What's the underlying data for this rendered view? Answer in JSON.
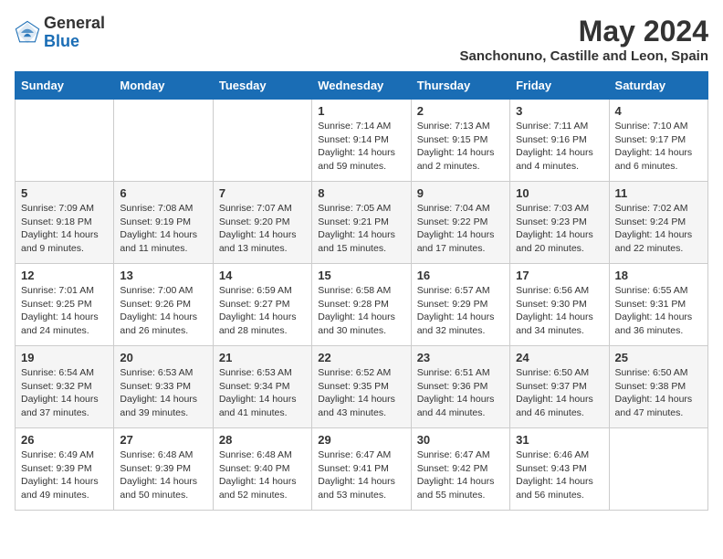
{
  "header": {
    "logo_general": "General",
    "logo_blue": "Blue",
    "title": "May 2024",
    "location": "Sanchonuno, Castille and Leon, Spain"
  },
  "columns": [
    "Sunday",
    "Monday",
    "Tuesday",
    "Wednesday",
    "Thursday",
    "Friday",
    "Saturday"
  ],
  "weeks": [
    [
      {
        "day": "",
        "info": ""
      },
      {
        "day": "",
        "info": ""
      },
      {
        "day": "",
        "info": ""
      },
      {
        "day": "1",
        "info": "Sunrise: 7:14 AM\nSunset: 9:14 PM\nDaylight: 14 hours and 59 minutes."
      },
      {
        "day": "2",
        "info": "Sunrise: 7:13 AM\nSunset: 9:15 PM\nDaylight: 14 hours and 2 minutes."
      },
      {
        "day": "3",
        "info": "Sunrise: 7:11 AM\nSunset: 9:16 PM\nDaylight: 14 hours and 4 minutes."
      },
      {
        "day": "4",
        "info": "Sunrise: 7:10 AM\nSunset: 9:17 PM\nDaylight: 14 hours and 6 minutes."
      }
    ],
    [
      {
        "day": "5",
        "info": "Sunrise: 7:09 AM\nSunset: 9:18 PM\nDaylight: 14 hours and 9 minutes."
      },
      {
        "day": "6",
        "info": "Sunrise: 7:08 AM\nSunset: 9:19 PM\nDaylight: 14 hours and 11 minutes."
      },
      {
        "day": "7",
        "info": "Sunrise: 7:07 AM\nSunset: 9:20 PM\nDaylight: 14 hours and 13 minutes."
      },
      {
        "day": "8",
        "info": "Sunrise: 7:05 AM\nSunset: 9:21 PM\nDaylight: 14 hours and 15 minutes."
      },
      {
        "day": "9",
        "info": "Sunrise: 7:04 AM\nSunset: 9:22 PM\nDaylight: 14 hours and 17 minutes."
      },
      {
        "day": "10",
        "info": "Sunrise: 7:03 AM\nSunset: 9:23 PM\nDaylight: 14 hours and 20 minutes."
      },
      {
        "day": "11",
        "info": "Sunrise: 7:02 AM\nSunset: 9:24 PM\nDaylight: 14 hours and 22 minutes."
      }
    ],
    [
      {
        "day": "12",
        "info": "Sunrise: 7:01 AM\nSunset: 9:25 PM\nDaylight: 14 hours and 24 minutes."
      },
      {
        "day": "13",
        "info": "Sunrise: 7:00 AM\nSunset: 9:26 PM\nDaylight: 14 hours and 26 minutes."
      },
      {
        "day": "14",
        "info": "Sunrise: 6:59 AM\nSunset: 9:27 PM\nDaylight: 14 hours and 28 minutes."
      },
      {
        "day": "15",
        "info": "Sunrise: 6:58 AM\nSunset: 9:28 PM\nDaylight: 14 hours and 30 minutes."
      },
      {
        "day": "16",
        "info": "Sunrise: 6:57 AM\nSunset: 9:29 PM\nDaylight: 14 hours and 32 minutes."
      },
      {
        "day": "17",
        "info": "Sunrise: 6:56 AM\nSunset: 9:30 PM\nDaylight: 14 hours and 34 minutes."
      },
      {
        "day": "18",
        "info": "Sunrise: 6:55 AM\nSunset: 9:31 PM\nDaylight: 14 hours and 36 minutes."
      }
    ],
    [
      {
        "day": "19",
        "info": "Sunrise: 6:54 AM\nSunset: 9:32 PM\nDaylight: 14 hours and 37 minutes."
      },
      {
        "day": "20",
        "info": "Sunrise: 6:53 AM\nSunset: 9:33 PM\nDaylight: 14 hours and 39 minutes."
      },
      {
        "day": "21",
        "info": "Sunrise: 6:53 AM\nSunset: 9:34 PM\nDaylight: 14 hours and 41 minutes."
      },
      {
        "day": "22",
        "info": "Sunrise: 6:52 AM\nSunset: 9:35 PM\nDaylight: 14 hours and 43 minutes."
      },
      {
        "day": "23",
        "info": "Sunrise: 6:51 AM\nSunset: 9:36 PM\nDaylight: 14 hours and 44 minutes."
      },
      {
        "day": "24",
        "info": "Sunrise: 6:50 AM\nSunset: 9:37 PM\nDaylight: 14 hours and 46 minutes."
      },
      {
        "day": "25",
        "info": "Sunrise: 6:50 AM\nSunset: 9:38 PM\nDaylight: 14 hours and 47 minutes."
      }
    ],
    [
      {
        "day": "26",
        "info": "Sunrise: 6:49 AM\nSunset: 9:39 PM\nDaylight: 14 hours and 49 minutes."
      },
      {
        "day": "27",
        "info": "Sunrise: 6:48 AM\nSunset: 9:39 PM\nDaylight: 14 hours and 50 minutes."
      },
      {
        "day": "28",
        "info": "Sunrise: 6:48 AM\nSunset: 9:40 PM\nDaylight: 14 hours and 52 minutes."
      },
      {
        "day": "29",
        "info": "Sunrise: 6:47 AM\nSunset: 9:41 PM\nDaylight: 14 hours and 53 minutes."
      },
      {
        "day": "30",
        "info": "Sunrise: 6:47 AM\nSunset: 9:42 PM\nDaylight: 14 hours and 55 minutes."
      },
      {
        "day": "31",
        "info": "Sunrise: 6:46 AM\nSunset: 9:43 PM\nDaylight: 14 hours and 56 minutes."
      },
      {
        "day": "",
        "info": ""
      }
    ]
  ]
}
